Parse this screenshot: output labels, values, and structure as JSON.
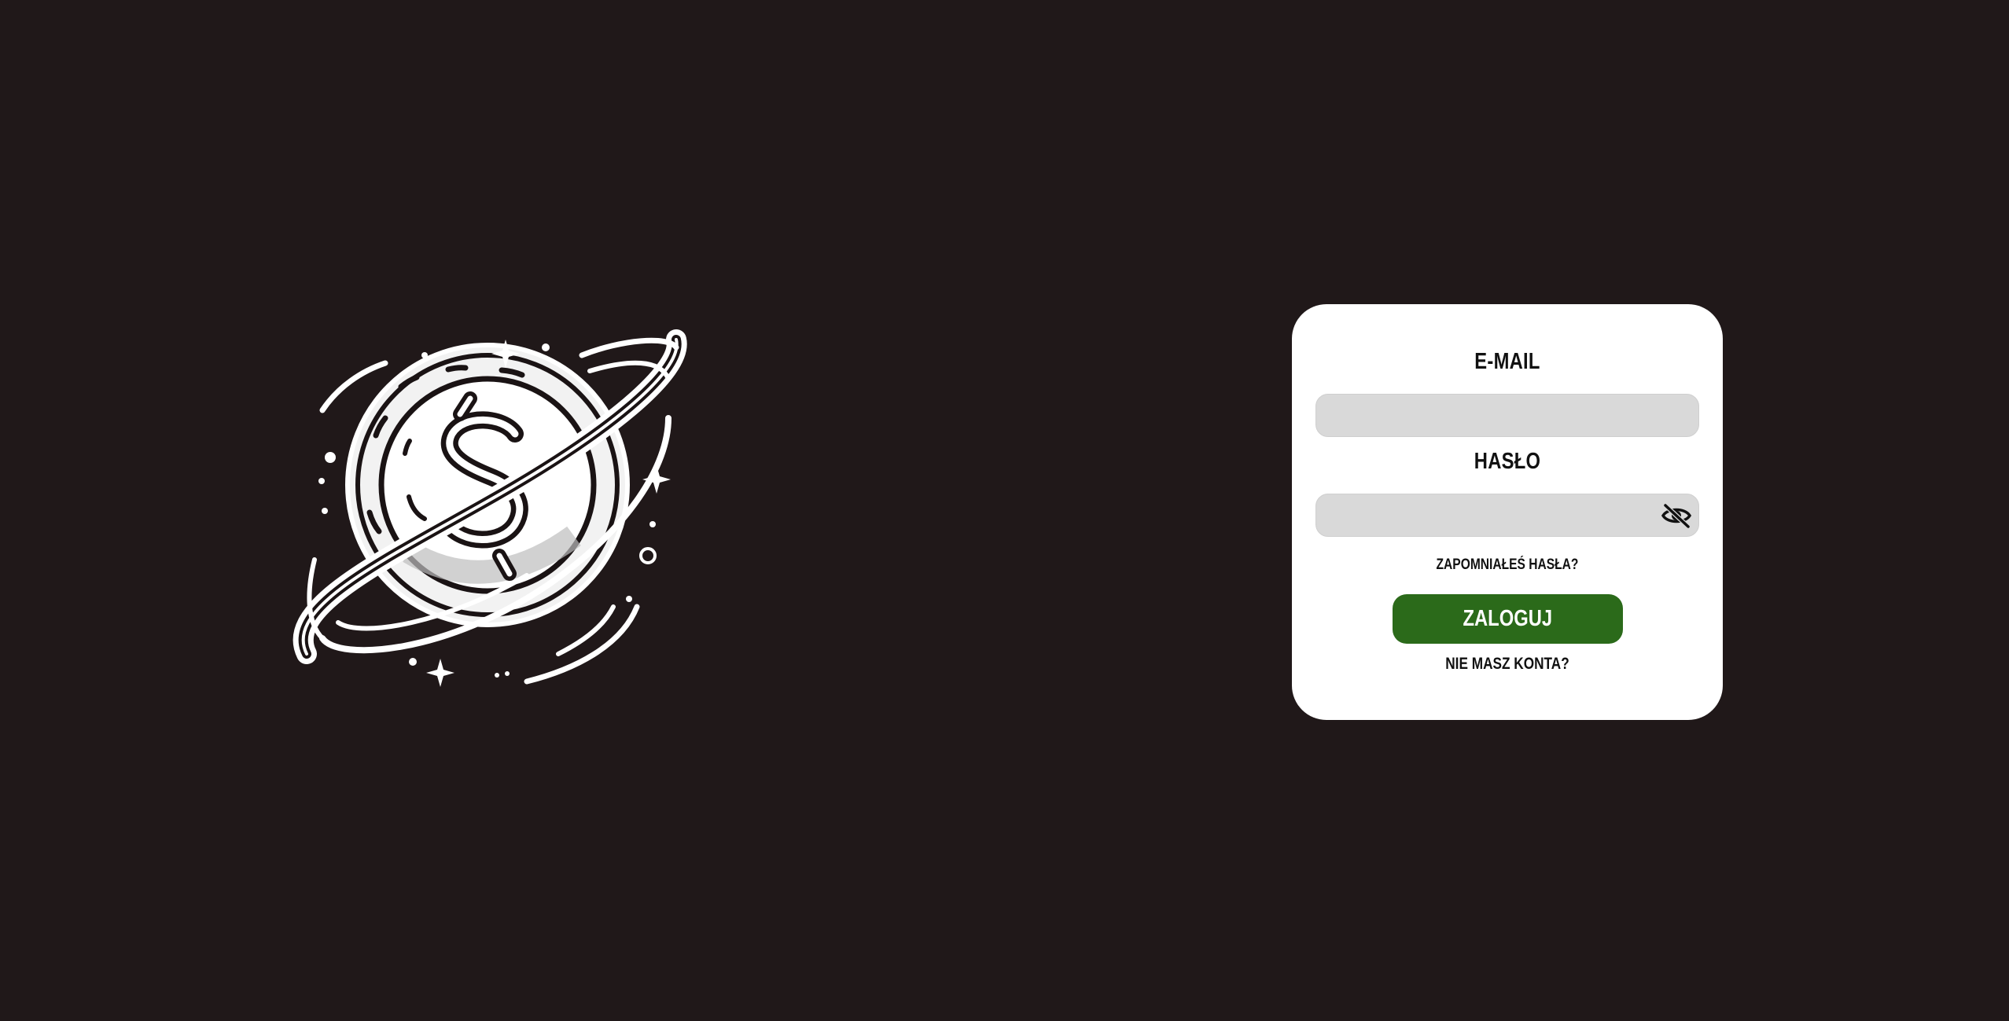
{
  "colors": {
    "background": "#201819",
    "card": "#ffffff",
    "input_fill": "#d9d9d9",
    "primary_button": "#2b6a1a",
    "text": "#111111"
  },
  "logo": {
    "icon": "planet-dollar-coin-logo"
  },
  "login_form": {
    "email_label": "E-MAIL",
    "email_value": "",
    "password_label": "HASŁO",
    "password_value": "",
    "password_toggle_icon": "eye-slash-icon",
    "forgot_password": "ZAPOMNIAŁEŚ HASŁA?",
    "submit_label": "ZALOGUJ",
    "signup_prompt": "NIE MASZ KONTA?"
  }
}
